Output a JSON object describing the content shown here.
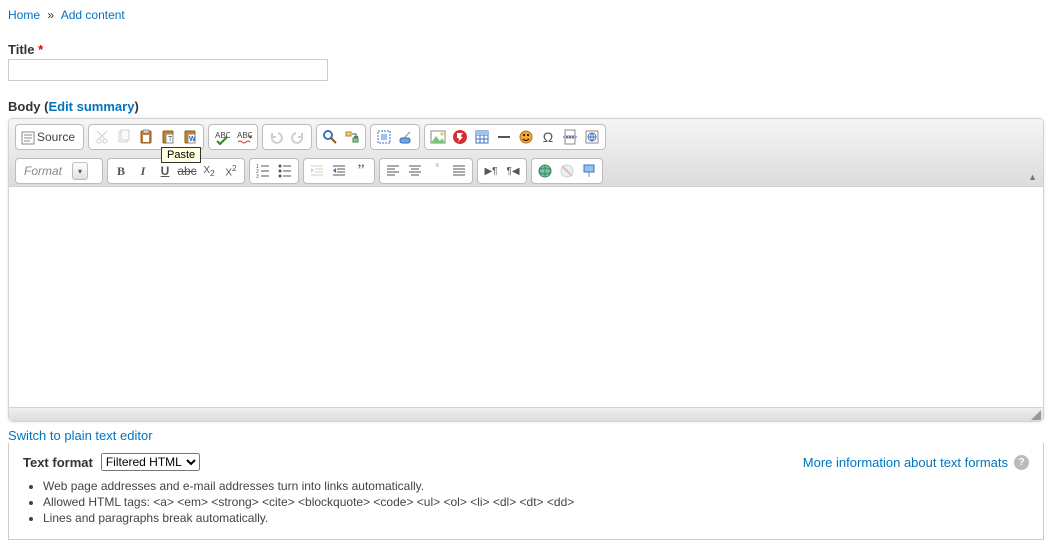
{
  "breadcrumb": {
    "home": "Home",
    "add": "Add content",
    "sep": "»"
  },
  "title": {
    "label": "Title",
    "value": ""
  },
  "body": {
    "label": "Body",
    "edit_summary": "Edit summary"
  },
  "toolbar": {
    "source": "Source",
    "format": "Format",
    "tooltip": "Paste"
  },
  "switch_plain": "Switch to plain text editor",
  "textformat": {
    "label": "Text format",
    "options": [
      "Filtered HTML"
    ],
    "selected": "Filtered HTML",
    "more": "More information about text formats",
    "tips": [
      "Web page addresses and e-mail addresses turn into links automatically.",
      "Allowed HTML tags: <a> <em> <strong> <cite> <blockquote> <code> <ul> <ol> <li> <dl> <dt> <dd>",
      "Lines and paragraphs break automatically."
    ]
  },
  "icons": {
    "cut": "cut",
    "copy": "copy",
    "paste": "paste",
    "paste_text": "paste_text",
    "paste_word": "paste_word",
    "spell": "spell",
    "scayt": "scayt",
    "undo": "undo",
    "redo": "redo",
    "find": "find",
    "replace": "replace",
    "selectall": "selectall",
    "remove_format": "remove_format",
    "image": "image",
    "flash": "flash",
    "table": "table",
    "hr": "hr",
    "smiley": "smiley",
    "specialchar": "specialchar",
    "pagebreak": "pagebreak",
    "iframe": "iframe",
    "bold": "bold",
    "italic": "italic",
    "underline": "underline",
    "strike": "strike",
    "subscript": "subscript",
    "superscript": "superscript",
    "numlist": "numlist",
    "bullist": "bullist",
    "outdent": "outdent",
    "indent": "indent",
    "quote": "quote",
    "left": "left",
    "center": "center",
    "right": "right",
    "justify": "justify",
    "ltr": "ltr",
    "rtl": "rtl",
    "link": "link",
    "unlink": "unlink",
    "anchor": "anchor"
  }
}
